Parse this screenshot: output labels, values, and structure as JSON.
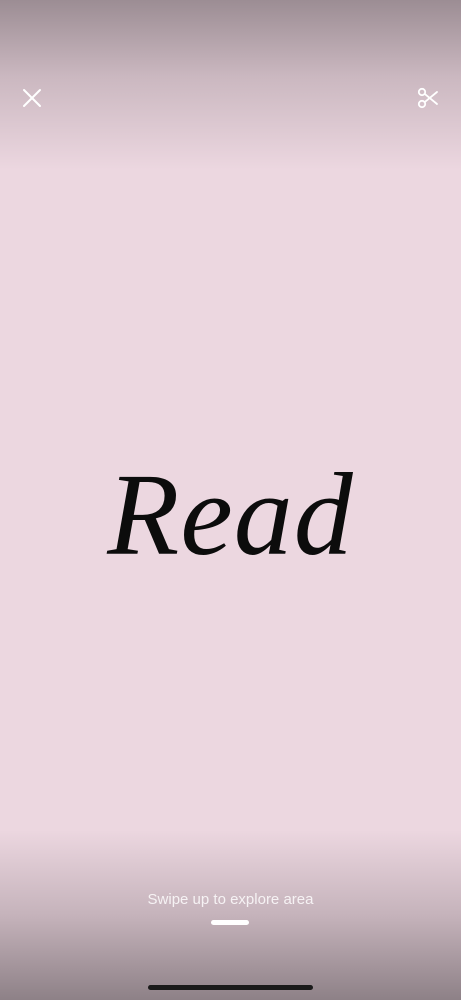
{
  "header": {
    "close_icon": "close-icon",
    "cut_icon": "scissors-icon"
  },
  "content": {
    "word": "Read"
  },
  "footer": {
    "hint": "Swipe up to explore area"
  },
  "colors": {
    "background": "#ecd7e0",
    "text": "#0c0c0c"
  }
}
